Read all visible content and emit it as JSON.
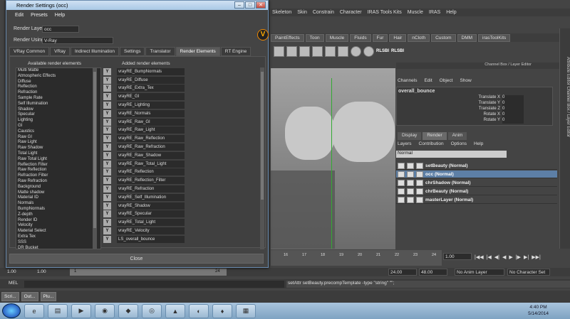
{
  "maya_menu": [
    "Skeleton",
    "Skin",
    "Constrain",
    "Character",
    "IRAS Tools Kits",
    "Muscle",
    "IRAS",
    "Help"
  ],
  "shelf_tabs": [
    "PaintEffects",
    "Toon",
    "Muscle",
    "Fluids",
    "Fur",
    "Hair",
    "nCloth",
    "Custom",
    "DMM",
    "irasToolKits"
  ],
  "shelf_labels": [
    "RLSBI",
    "RLSBI"
  ],
  "channel_box": {
    "header": "Channel Box / Layer Editor",
    "menu": [
      "Channels",
      "Edit",
      "Object",
      "Show"
    ],
    "object": "overall_bounce",
    "attrs": [
      {
        "name": "Translate X",
        "value": "0"
      },
      {
        "name": "Translate Y",
        "value": "0"
      },
      {
        "name": "Translate Z",
        "value": "0"
      },
      {
        "name": "Rotate X",
        "value": "0"
      },
      {
        "name": "Rotate Y",
        "value": "0"
      }
    ]
  },
  "layer_editor": {
    "tabs": [
      "Display",
      "Render",
      "Anim"
    ],
    "menu": [
      "Layers",
      "Contribution",
      "Options",
      "Help"
    ],
    "mode": "Normal",
    "layers": [
      "setBeauty (Normal)",
      "occ (Normal)",
      "chrShadow (Normal)",
      "chrBeauty (Normal)",
      "masterLayer (Normal)"
    ]
  },
  "sidebar_text": "Attribute Editor    Channel Box / Layer Editor",
  "timeline": {
    "ticks": [
      "16",
      "17",
      "18",
      "19",
      "20",
      "21",
      "22",
      "23",
      "24"
    ],
    "current_frame": "1.00"
  },
  "range": {
    "start": "1.00",
    "start2": "1.00",
    "mid": "1",
    "end_marker": "24",
    "end": "24.00",
    "end2": "48.00",
    "anim_layer": "No Anim Layer",
    "char_set": "No Character Set"
  },
  "mel": {
    "label": "MEL",
    "result": "setAttr setBeauty.precompTemplate -type \"string\" \"\";"
  },
  "window_buttons": [
    "Scri...",
    "Out...",
    "Plu..."
  ],
  "clock": {
    "time": "4:40 PM",
    "date": "5/14/2014"
  },
  "dialog": {
    "title": "Render Settings (occ)",
    "menu": [
      "Edit",
      "Presets",
      "Help"
    ],
    "render_layer_label": "Render Layer",
    "render_layer_value": "occ",
    "render_using_label": "Render Using",
    "render_using_value": "V-Ray",
    "tabs": [
      "VRay Common",
      "VRay",
      "Indirect Illumination",
      "Settings",
      "Translator",
      "Render Elements",
      "RT Engine"
    ],
    "available_header": "Available render elements",
    "added_header": "Added render elements",
    "available": [
      "Multi Matte",
      "Atmospheric Effects",
      "Diffuse",
      "Reflection",
      "Refraction",
      "Sample Rate",
      "Self Illumination",
      "Shadow",
      "Specular",
      "Lighting",
      "GI",
      "Caustics",
      "Raw GI",
      "Raw Light",
      "Raw Shadow",
      "Total Light",
      "Raw Total Light",
      "Reflection Filter",
      "Raw Reflection",
      "Refraction Filter",
      "Raw Refraction",
      "Background",
      "Matte shadow",
      "Material ID",
      "Normals",
      "BumpNormals",
      "Z-depth",
      "Render ID",
      "Velocity",
      "Material Select",
      "Extra Tex",
      "SSS",
      "DR Bucket"
    ],
    "added": [
      "vrayRE_BumpNormals",
      "vrayRE_Diffuse",
      "vrayRE_Extra_Tex",
      "vrayRE_GI",
      "vrayRE_Lighting",
      "vrayRE_Normals",
      "vrayRE_Raw_GI",
      "vrayRE_Raw_Light",
      "vrayRE_Raw_Reflection",
      "vrayRE_Raw_Refraction",
      "vrayRE_Raw_Shadow",
      "vrayRE_Raw_Total_Light",
      "vrayRE_Reflection",
      "vrayRE_Reflection_Filter",
      "vrayRE_Refraction",
      "vrayRE_Self_Illumination",
      "vrayRE_Shadow",
      "vrayRE_Specular",
      "vrayRE_Total_Light",
      "vrayRE_Velocity",
      "LS_overall_bounce"
    ],
    "toggle_label": "Y",
    "close_label": "Close"
  }
}
